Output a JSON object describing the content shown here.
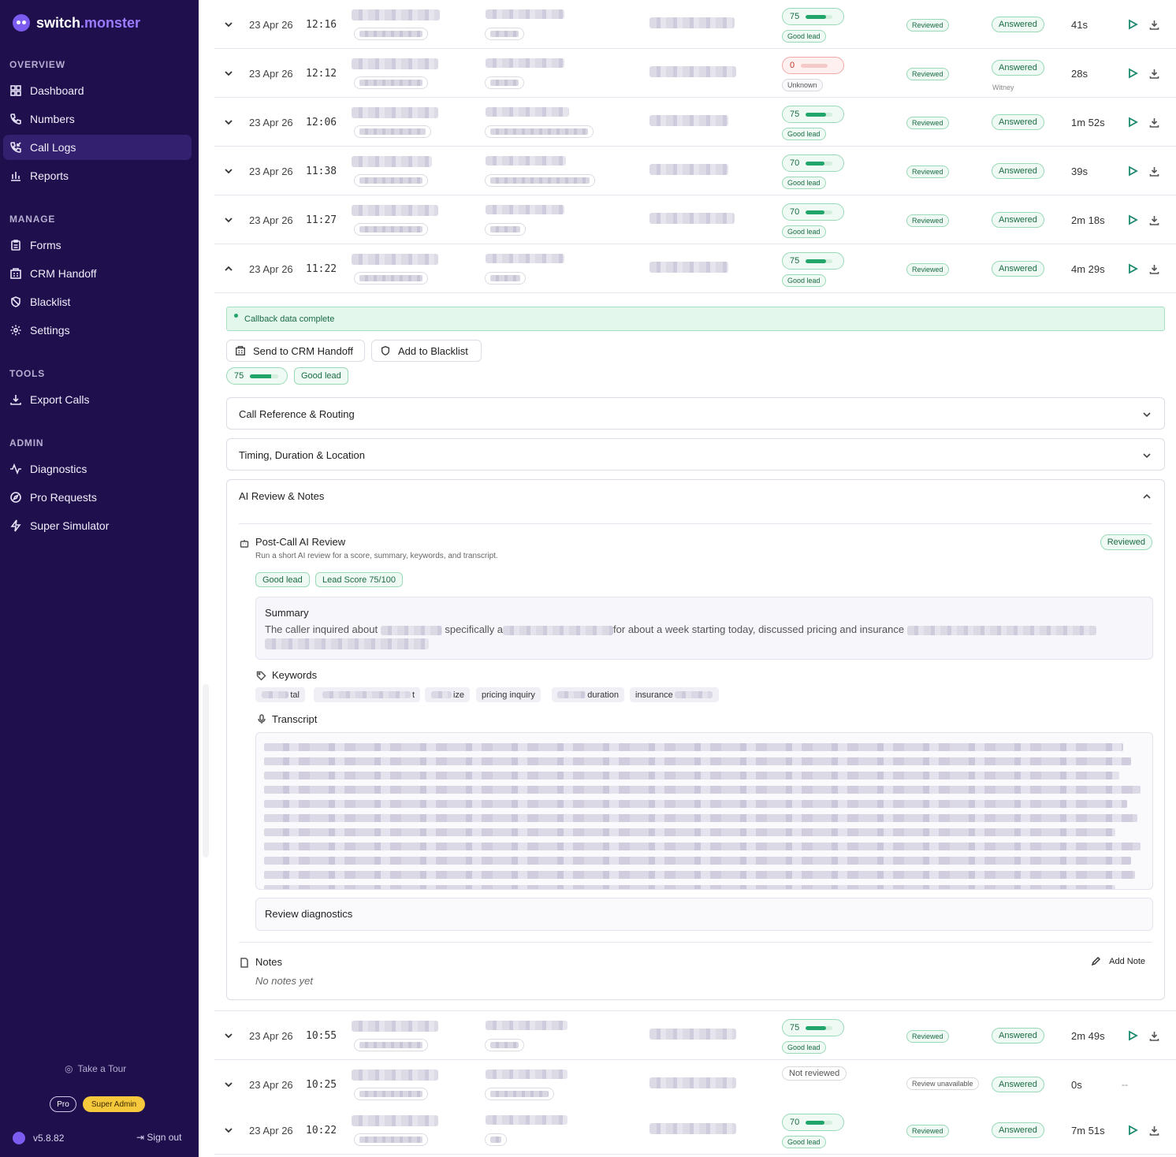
{
  "brand": {
    "part1": "switch",
    "part2": ".monster"
  },
  "sidebar": {
    "sections": {
      "overview": "OVERVIEW",
      "manage": "MANAGE",
      "tools": "TOOLS",
      "admin": "ADMIN"
    },
    "items": [
      {
        "label": "Dashboard",
        "icon": "grid-icon"
      },
      {
        "label": "Numbers",
        "icon": "phone-icon"
      },
      {
        "label": "Call Logs",
        "icon": "phone-incoming-icon",
        "active": true
      },
      {
        "label": "Reports",
        "icon": "bar-chart-icon"
      },
      {
        "label": "Forms",
        "icon": "clipboard-icon"
      },
      {
        "label": "CRM Handoff",
        "icon": "building-icon"
      },
      {
        "label": "Blacklist",
        "icon": "ban-icon"
      },
      {
        "label": "Settings",
        "icon": "gear-icon"
      },
      {
        "label": "Export Calls",
        "icon": "download-icon"
      },
      {
        "label": "Diagnostics",
        "icon": "activity-icon"
      },
      {
        "label": "Pro Requests",
        "icon": "compass-icon"
      },
      {
        "label": "Super Simulator",
        "icon": "lightning-icon"
      }
    ],
    "tour": "Take a Tour",
    "plan": "Pro",
    "role": "Super Admin",
    "version": "v5.8.82",
    "signout": "Sign out"
  },
  "rows_top": [
    {
      "date": "23 Apr 26",
      "time": "12:16",
      "score": 75,
      "lead": "Good lead",
      "review": "Reviewed",
      "status": "Answered",
      "status_sub": "",
      "duration": "41s",
      "expanded": false
    },
    {
      "date": "23 Apr 26",
      "time": "12:12",
      "score": 0,
      "lead": "Unknown",
      "review": "Reviewed",
      "status": "Answered",
      "status_sub": "Witney",
      "duration": "28s",
      "expanded": false
    },
    {
      "date": "23 Apr 26",
      "time": "12:06",
      "score": 75,
      "lead": "Good lead",
      "review": "Reviewed",
      "status": "Answered",
      "status_sub": "",
      "duration": "1m 52s",
      "expanded": false
    },
    {
      "date": "23 Apr 26",
      "time": "11:38",
      "score": 70,
      "lead": "Good lead",
      "review": "Reviewed",
      "status": "Answered",
      "status_sub": "",
      "duration": "39s",
      "expanded": false
    },
    {
      "date": "23 Apr 26",
      "time": "11:27",
      "score": 70,
      "lead": "Good lead",
      "review": "Reviewed",
      "status": "Answered",
      "status_sub": "",
      "duration": "2m 18s",
      "expanded": false
    },
    {
      "date": "23 Apr 26",
      "time": "11:22",
      "score": 75,
      "lead": "Good lead",
      "review": "Reviewed",
      "status": "Answered",
      "status_sub": "",
      "duration": "4m 29s",
      "expanded": true
    }
  ],
  "rows_bottom": [
    {
      "date": "23 Apr 26",
      "time": "10:55",
      "score": 75,
      "lead": "Good lead",
      "review": "Reviewed",
      "status": "Answered",
      "duration": "2m 49s",
      "not_reviewed": false
    },
    {
      "date": "23 Apr 26",
      "time": "10:25",
      "score": null,
      "lead": "",
      "review": "Review unavailable",
      "status": "Answered",
      "duration": "0s",
      "not_reviewed": true,
      "not_reviewed_label": "Not reviewed",
      "action_dash": "--"
    },
    {
      "date": "23 Apr 26",
      "time": "10:22",
      "score": 70,
      "lead": "Good lead",
      "review": "Reviewed",
      "status": "Answered",
      "duration": "7m 51s",
      "not_reviewed": false
    }
  ],
  "detail": {
    "callback": "Callback data complete",
    "send_crm": "Send to CRM Handoff",
    "add_blacklist": "Add to Blacklist",
    "score": 75,
    "lead": "Good lead",
    "acc1": "Call Reference & Routing",
    "acc2": "Timing, Duration & Location",
    "acc3": "AI Review & Notes",
    "pcr_title": "Post-Call AI Review",
    "pcr_sub": "Run a short AI review for a score, summary, keywords, and transcript.",
    "pcr_badge": "Reviewed",
    "chip_good": "Good lead",
    "chip_score": "Lead Score 75/100",
    "summary_title": "Summary",
    "summary_t1": "The caller inquired about",
    "summary_t2": "specifically a",
    "summary_t3": "for about a week starting today, discussed pricing and insurance",
    "keywords_title": "Keywords",
    "keywords": [
      "tal",
      "t",
      "ize",
      "pricing inquiry",
      "duration",
      "insurance"
    ],
    "transcript_title": "Transcript",
    "diag_title": "Review diagnostics",
    "notes_title": "Notes",
    "notes_empty": "No notes yet",
    "add_note": "Add Note"
  },
  "colors": {
    "sidebar": "#1f0f4d",
    "accent": "#22a56a",
    "brand": "#9b7cff"
  }
}
